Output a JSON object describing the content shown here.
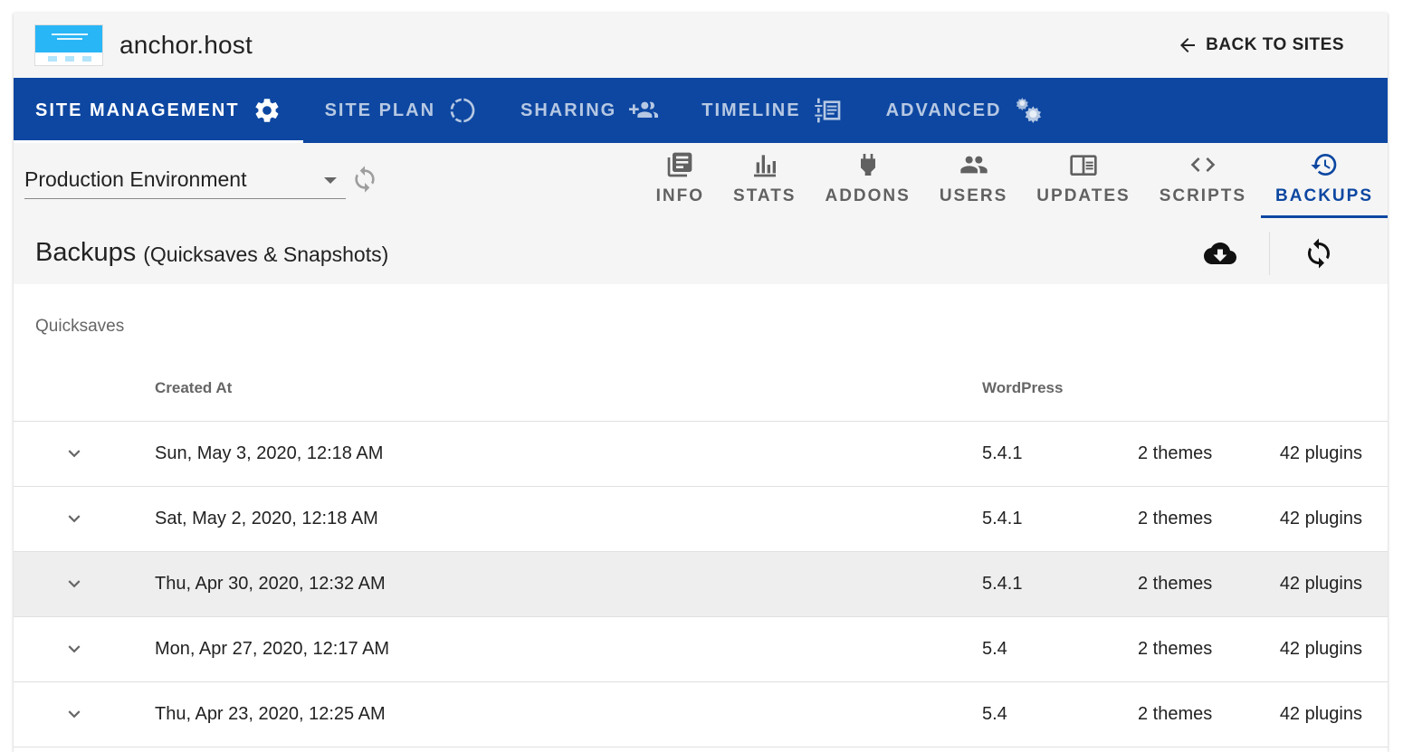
{
  "header": {
    "site_title": "anchor.host",
    "back_label": "BACK TO SITES"
  },
  "nav": {
    "tabs": [
      {
        "label": "SITE MANAGEMENT",
        "icon": "gear-icon",
        "active": true
      },
      {
        "label": "SITE PLAN",
        "icon": "progress-circle-icon",
        "active": false
      },
      {
        "label": "SHARING",
        "icon": "account-plus-icon",
        "active": false
      },
      {
        "label": "TIMELINE",
        "icon": "timeline-text-icon",
        "active": false
      },
      {
        "label": "ADVANCED",
        "icon": "cogs-icon",
        "active": false
      }
    ]
  },
  "environment": {
    "selected": "Production Environment"
  },
  "subtabs": [
    {
      "label": "INFO",
      "icon": "newspaper-icon",
      "active": false
    },
    {
      "label": "STATS",
      "icon": "bar-chart-icon",
      "active": false
    },
    {
      "label": "ADDONS",
      "icon": "power-plug-icon",
      "active": false
    },
    {
      "label": "USERS",
      "icon": "users-icon",
      "active": false
    },
    {
      "label": "UPDATES",
      "icon": "book-open-icon",
      "active": false
    },
    {
      "label": "SCRIPTS",
      "icon": "code-icon",
      "active": false
    },
    {
      "label": "BACKUPS",
      "icon": "backup-restore-icon",
      "active": true
    }
  ],
  "section": {
    "title": "Backups",
    "subtitle": "(Quicksaves & Snapshots)"
  },
  "quicksaves": {
    "label": "Quicksaves",
    "headers": {
      "created_at": "Created At",
      "wordpress": "WordPress"
    },
    "rows": [
      {
        "created_at": "Sun, May 3, 2020, 12:18 AM",
        "wordpress": "5.4.1",
        "themes": "2 themes",
        "plugins": "42 plugins"
      },
      {
        "created_at": "Sat, May 2, 2020, 12:18 AM",
        "wordpress": "5.4.1",
        "themes": "2 themes",
        "plugins": "42 plugins"
      },
      {
        "created_at": "Thu, Apr 30, 2020, 12:32 AM",
        "wordpress": "5.4.1",
        "themes": "2 themes",
        "plugins": "42 plugins"
      },
      {
        "created_at": "Mon, Apr 27, 2020, 12:17 AM",
        "wordpress": "5.4",
        "themes": "2 themes",
        "plugins": "42 plugins"
      },
      {
        "created_at": "Thu, Apr 23, 2020, 12:25 AM",
        "wordpress": "5.4",
        "themes": "2 themes",
        "plugins": "42 plugins"
      }
    ]
  },
  "colors": {
    "nav_bg": "#0d47a1",
    "accent": "#0d47a1",
    "header_bg": "#f5f5f5",
    "row_hover": "#eeeeee"
  }
}
